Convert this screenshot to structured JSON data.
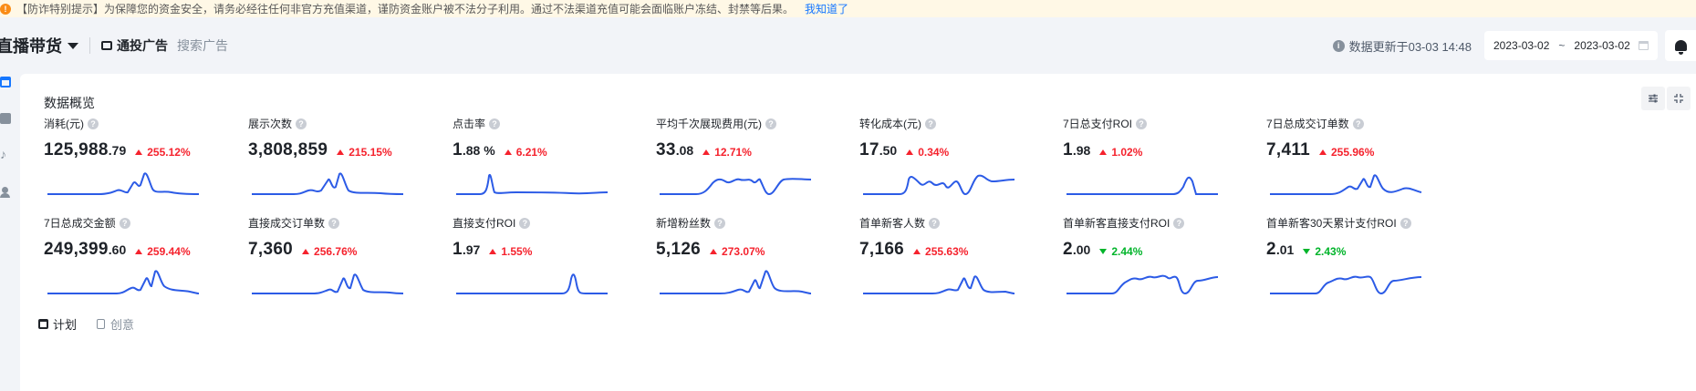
{
  "notice": {
    "text": "【防诈特别提示】为保障您的资金安全，请务必经往任何非官方充值渠道，谨防资金账户被不法分子利用。通过不法渠道充值可能会面临账户冻结、封禁等后果。",
    "link": "我知道了",
    "icon": "warning-icon"
  },
  "header": {
    "title": "直播带货",
    "tabs": [
      {
        "label": "通投广告",
        "active": true
      },
      {
        "label": "搜索广告",
        "active": false
      }
    ],
    "update_text": "数据更新于03-03 14:48",
    "date_start": "2023-03-02",
    "date_sep": "~",
    "date_end": "2023-03-02"
  },
  "overview": {
    "title": "数据概览",
    "metrics": [
      {
        "label": "消耗(元)",
        "int": "125,988",
        "dec": ".79",
        "change": "255.12%",
        "dir": "up"
      },
      {
        "label": "展示次数",
        "int": "3,808,859",
        "dec": "",
        "change": "215.15%",
        "dir": "up"
      },
      {
        "label": "点击率",
        "int": "1",
        "dec": ".88 %",
        "change": "6.21%",
        "dir": "up"
      },
      {
        "label": "平均千次展现费用(元)",
        "int": "33",
        "dec": ".08",
        "change": "12.71%",
        "dir": "up"
      },
      {
        "label": "转化成本(元)",
        "int": "17",
        "dec": ".50",
        "change": "0.34%",
        "dir": "up"
      },
      {
        "label": "7日总支付ROI",
        "int": "1",
        "dec": ".98",
        "change": "1.02%",
        "dir": "up"
      },
      {
        "label": "7日总成交订单数",
        "int": "7,411",
        "dec": "",
        "change": "255.96%",
        "dir": "up"
      },
      {
        "label": "7日总成交金额",
        "int": "249,399",
        "dec": ".60",
        "change": "259.44%",
        "dir": "up"
      },
      {
        "label": "直接成交订单数",
        "int": "7,360",
        "dec": "",
        "change": "256.76%",
        "dir": "up"
      },
      {
        "label": "直接支付ROI",
        "int": "1",
        "dec": ".97",
        "change": "1.55%",
        "dir": "up"
      },
      {
        "label": "新增粉丝数",
        "int": "5,126",
        "dec": "",
        "change": "273.07%",
        "dir": "up"
      },
      {
        "label": "首单新客人数",
        "int": "7,166",
        "dec": "",
        "change": "255.63%",
        "dir": "up"
      },
      {
        "label": "首单新客直接支付ROI",
        "int": "2",
        "dec": ".00",
        "change": "2.44%",
        "dir": "down"
      },
      {
        "label": "首单新客30天累计支付ROI",
        "int": "2",
        "dec": ".01",
        "change": "2.43%",
        "dir": "down"
      }
    ]
  },
  "bottom_tabs": [
    {
      "label": "计划",
      "active": true
    },
    {
      "label": "创意",
      "active": false
    }
  ],
  "colors": {
    "accent": "#1677ff",
    "line": "#2c5be6",
    "up": "#f5222d",
    "down": "#00b42a"
  }
}
